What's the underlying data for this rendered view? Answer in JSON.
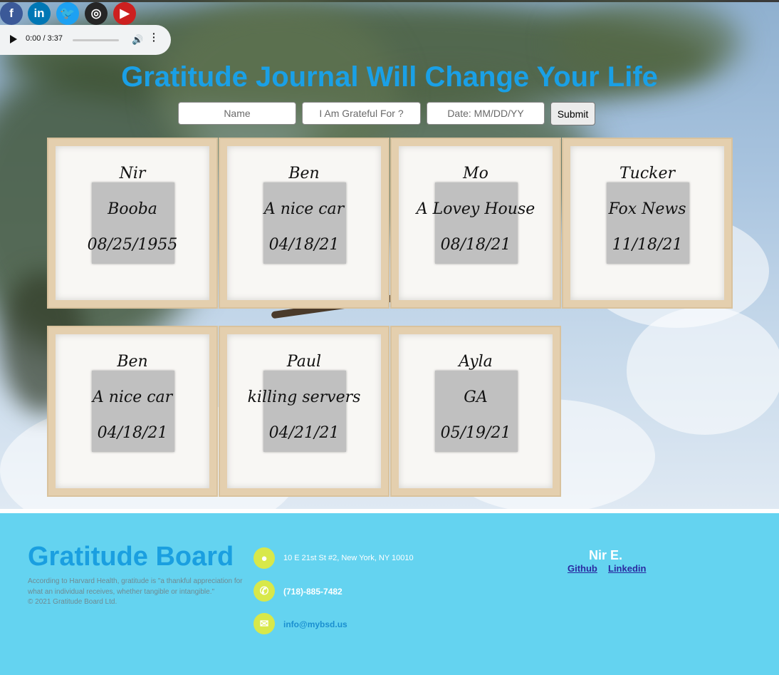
{
  "social": [
    {
      "icon": "facebook-icon",
      "glyph": "f",
      "color": "#3b5998"
    },
    {
      "icon": "linkedin-icon",
      "glyph": "in",
      "color": "#0077b5"
    },
    {
      "icon": "twitter-icon",
      "glyph": "🐦",
      "color": "#1da1f2"
    },
    {
      "icon": "instagram-icon",
      "glyph": "◎",
      "color": "#262626"
    },
    {
      "icon": "youtube-icon",
      "glyph": "▶",
      "color": "#cd201f"
    }
  ],
  "audio": {
    "time": "0:00 / 3:37",
    "progress": 0
  },
  "header": {
    "title": "Gratitude Journal Will Change Your Life"
  },
  "form": {
    "name_placeholder": "Name",
    "grateful_placeholder": "I Am Grateful For ?",
    "date_placeholder": "Date: MM/DD/YY",
    "submit_label": "Submit"
  },
  "cards": [
    {
      "name": "Nir",
      "grateful": "Booba",
      "date": "08/25/1955"
    },
    {
      "name": "Ben",
      "grateful": "A nice car",
      "date": "04/18/21"
    },
    {
      "name": "Mo",
      "grateful": "A Lovey House",
      "date": "08/18/21"
    },
    {
      "name": "Tucker",
      "grateful": "Fox News",
      "date": "11/18/21"
    },
    {
      "name": "Ben",
      "grateful": "A nice car",
      "date": "04/18/21"
    },
    {
      "name": "Paul",
      "grateful": "killing servers",
      "date": "04/21/21"
    },
    {
      "name": "Ayla",
      "grateful": "GA",
      "date": "05/19/21"
    }
  ],
  "footer": {
    "brand": "Gratitude Board",
    "description": "According to Harvard Health, gratitude is \"a thankful appreciation for what an individual receives, whether tangible or intangible.\"",
    "copyright": "© 2021 Gratitude Board Ltd.",
    "address": "10 E 21st St #2, New York, NY 10010",
    "phone": "(718)-885-7482",
    "email": "info@mybsd.us",
    "author": "Nir E.",
    "github_label": "Github",
    "linkedin_label": "Linkedin"
  },
  "colors": {
    "title": "#1aa0e6",
    "footer_bg": "#64d3f0",
    "footer_icon": "#d8e84a",
    "frame": "#e4cfae"
  }
}
